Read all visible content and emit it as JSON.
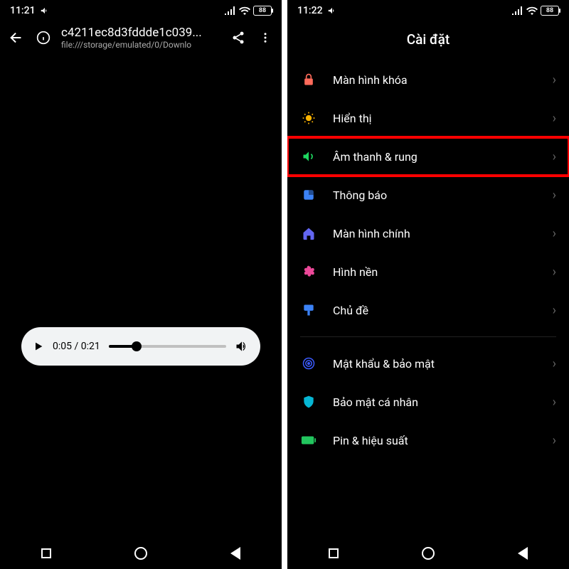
{
  "left": {
    "statusbar": {
      "time": "11:21",
      "battery": "88"
    },
    "browser": {
      "title": "c4211ec8d3fddde1c039...",
      "subtitle": "file:///storage/emulated/0/Downlo"
    },
    "player": {
      "current": "0:05",
      "duration": "0:21"
    }
  },
  "right": {
    "statusbar": {
      "time": "11:22",
      "battery": "88"
    },
    "title": "Cài đặt",
    "items": [
      {
        "label": "Màn hình khóa",
        "icon": "lock",
        "color": "#ff6b5b"
      },
      {
        "label": "Hiển thị",
        "icon": "sun",
        "color": "#ffb400"
      },
      {
        "label": "Âm thanh & rung",
        "icon": "speaker",
        "color": "#1ed760",
        "highlight": true
      },
      {
        "label": "Thông báo",
        "icon": "square",
        "color": "#3b82f6"
      },
      {
        "label": "Màn hình chính",
        "icon": "home",
        "color": "#6366f1"
      },
      {
        "label": "Hình nền",
        "icon": "flower",
        "color": "#ec4899"
      },
      {
        "label": "Chủ đề",
        "icon": "brush",
        "color": "#3b82f6"
      }
    ],
    "items2": [
      {
        "label": "Mật khẩu & bảo mật",
        "icon": "fingerprint",
        "color": "#3b5bff"
      },
      {
        "label": "Bảo mật cá nhân",
        "icon": "shield",
        "color": "#06b6d4"
      },
      {
        "label": "Pin & hiệu suất",
        "icon": "battery",
        "color": "#22c55e"
      }
    ]
  }
}
